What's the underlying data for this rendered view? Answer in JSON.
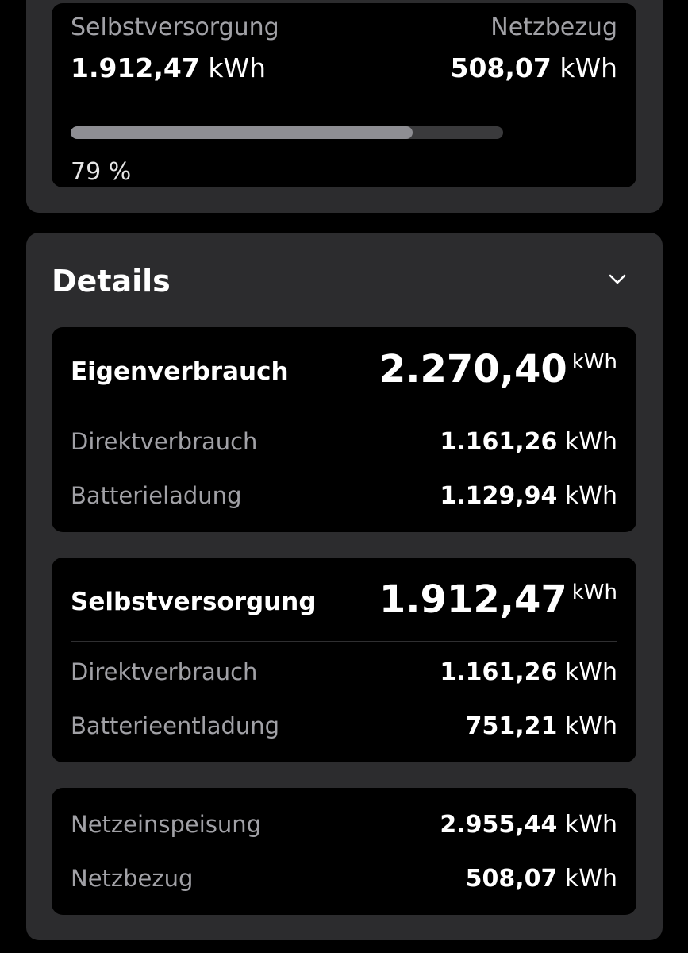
{
  "summary": {
    "left_label": "Selbstversorgung",
    "left_value": "1.912,47",
    "left_unit": "kWh",
    "right_label": "Netzbezug",
    "right_value": "508,07",
    "right_unit": "kWh",
    "progress_percent": 79,
    "progress_text": "79 %"
  },
  "details": {
    "title": "Details",
    "cards": [
      {
        "title": "Eigenverbrauch",
        "total": "2.270,40",
        "unit": "kWh",
        "rows": [
          {
            "label": "Direktverbrauch",
            "value": "1.161,26",
            "unit": "kWh"
          },
          {
            "label": "Batterieladung",
            "value": "1.129,94",
            "unit": "kWh"
          }
        ]
      },
      {
        "title": "Selbstversorgung",
        "total": "1.912,47",
        "unit": "kWh",
        "rows": [
          {
            "label": "Direktverbrauch",
            "value": "1.161,26",
            "unit": "kWh"
          },
          {
            "label": "Batterieentladung",
            "value": "751,21",
            "unit": "kWh"
          }
        ]
      },
      {
        "rows": [
          {
            "label": "Netzeinspeisung",
            "value": "2.955,44",
            "unit": "kWh"
          },
          {
            "label": "Netzbezug",
            "value": "508,07",
            "unit": "kWh"
          }
        ]
      }
    ]
  },
  "colors": {
    "background": "#000000",
    "panel": "#2c2c2e",
    "muted_text": "#a1a1a6",
    "bar_fill": "#8e8e93"
  },
  "icons": {
    "expand": "chevron-down-icon"
  }
}
